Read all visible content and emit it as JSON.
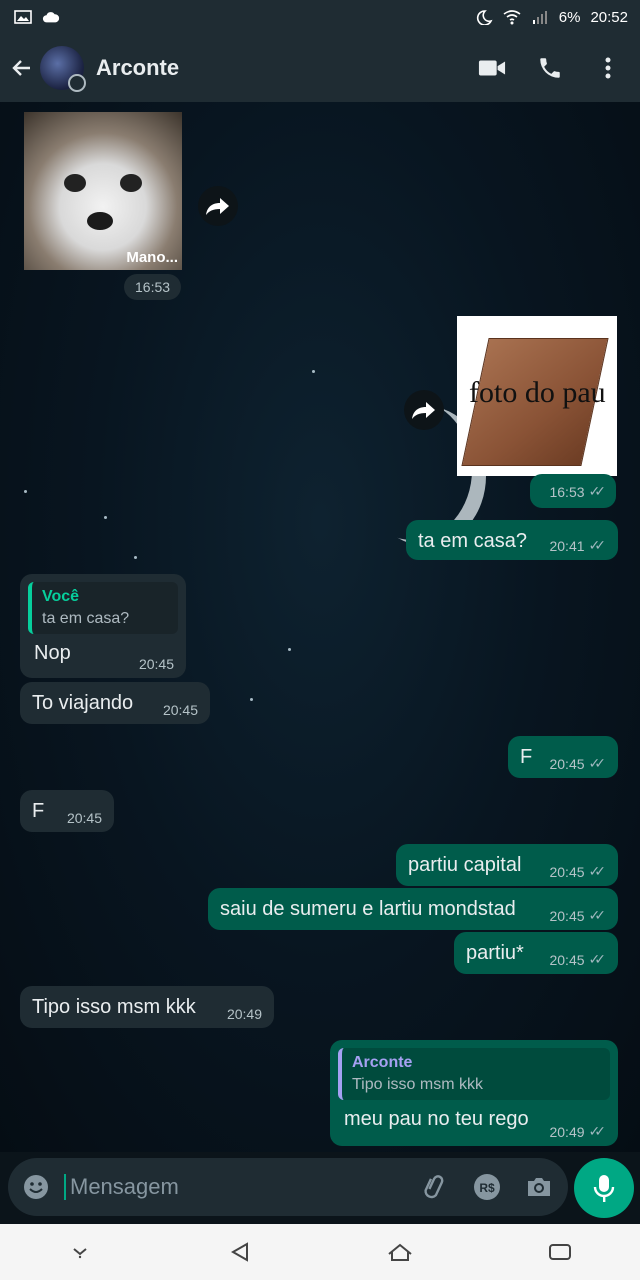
{
  "status_bar": {
    "battery": "6%",
    "time": "20:52"
  },
  "header": {
    "contact_name": "Arconte"
  },
  "messages": [
    {
      "dir": "in",
      "type": "image",
      "caption": "Mano...",
      "time": "16:53"
    },
    {
      "dir": "out",
      "type": "image",
      "image_text": "foto do pau",
      "time": "16:53"
    },
    {
      "dir": "out",
      "text": "ta em casa?",
      "time": "20:41"
    },
    {
      "dir": "in",
      "quote_name": "Você",
      "quote_text": "ta em casa?",
      "text": "Nop",
      "time": "20:45"
    },
    {
      "dir": "in",
      "text": "To viajando",
      "time": "20:45"
    },
    {
      "dir": "out",
      "text": "F",
      "time": "20:45"
    },
    {
      "dir": "in",
      "text": "F",
      "time": "20:45"
    },
    {
      "dir": "out",
      "text": "partiu capital",
      "time": "20:45"
    },
    {
      "dir": "out",
      "text": "saiu de sumeru e lartiu mondstad",
      "time": "20:45"
    },
    {
      "dir": "out",
      "text": "partiu*",
      "time": "20:45"
    },
    {
      "dir": "in",
      "text": "Tipo isso msm kkk",
      "time": "20:49"
    },
    {
      "dir": "out",
      "quote_name": "Arconte",
      "quote_text": "Tipo isso msm kkk",
      "text": "meu pau no teu rego",
      "time": "20:49"
    }
  ],
  "composer": {
    "placeholder": "Mensagem"
  },
  "icons": {
    "back": "arrow-left-icon",
    "video": "video-call-icon",
    "phone": "phone-icon",
    "menu": "more-vert-icon",
    "emoji": "emoji-icon",
    "attach": "paperclip-icon",
    "payment": "rs-payment-icon",
    "camera": "camera-icon",
    "mic": "mic-icon"
  },
  "colors": {
    "outgoing_bubble": "#005c4b",
    "incoming_bubble": "#1f2c33",
    "accent": "#00a884"
  }
}
